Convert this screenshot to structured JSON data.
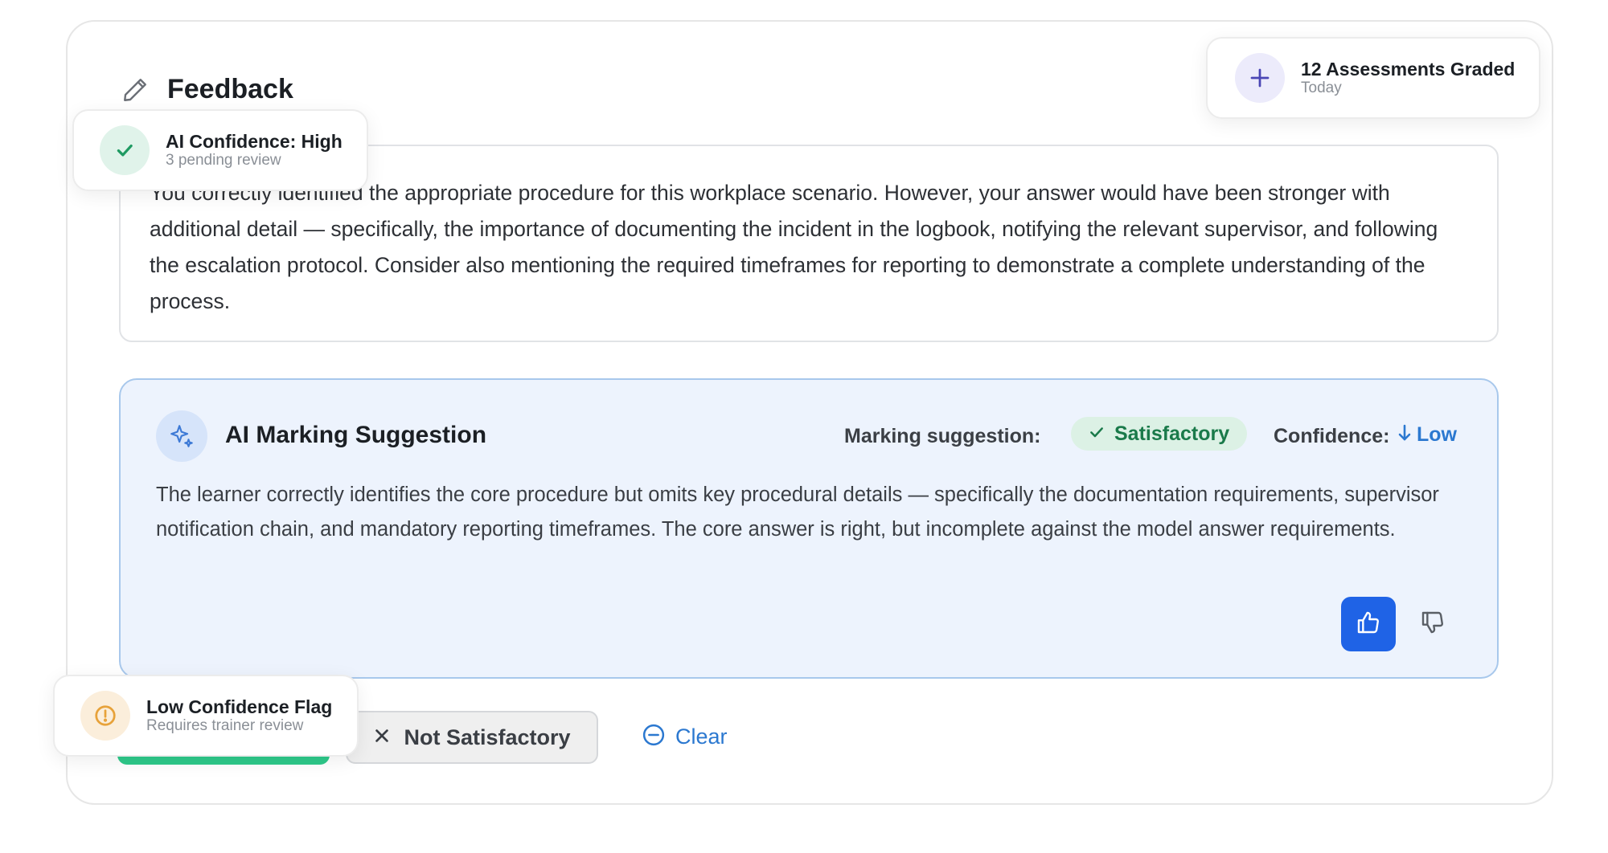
{
  "feedback": {
    "title": "Feedback",
    "text": "You correctly identified the appropriate procedure for this workplace scenario. However, your answer would have been stronger with additional detail — specifically, the importance of documenting the incident in the logbook, notifying the relevant supervisor, and following the escalation protocol. Consider also mentioning the required timeframes for reporting to demonstrate a complete understanding of the process."
  },
  "ai_suggestion": {
    "title": "AI Marking Suggestion",
    "marking_label": "Marking suggestion:",
    "marking_value": "Satisfactory",
    "confidence_label": "Confidence:",
    "confidence_value": "Low",
    "text": "The learner correctly identifies the core procedure but omits key procedural details — specifically the documentation requirements, supervisor notification chain, and mandatory reporting timeframes. The core answer is right, but incomplete against the model answer requirements."
  },
  "actions": {
    "not_satisfactory_label": "Not Satisfactory",
    "clear_label": "Clear"
  },
  "floating": {
    "graded": {
      "title": "12 Assessments Graded",
      "subtitle": "Today"
    },
    "confidence": {
      "title": "AI Confidence: High",
      "subtitle": "3 pending review"
    },
    "low_flag": {
      "title": "Low Confidence Flag",
      "subtitle": "Requires trainer review"
    }
  },
  "colors": {
    "accent_blue": "#1f63e6",
    "link_blue": "#2b78d0",
    "success_green": "#1a7a4a",
    "button_green": "#2ec98a",
    "warning_orange": "#e7a23a",
    "ai_panel_bg": "#edf3fd"
  },
  "icons": {
    "feedback": "pencil-icon",
    "ai": "sparkle-icon",
    "satisfactory": "check-icon",
    "confidence": "arrow-down-icon",
    "approve": "thumbs-up-icon",
    "reject": "thumbs-down-icon",
    "not_satisfactory": "close-icon",
    "clear": "minus-circle-icon",
    "graded": "plus-icon",
    "ai_confidence": "check-icon",
    "low_flag": "alert-circle-icon"
  }
}
